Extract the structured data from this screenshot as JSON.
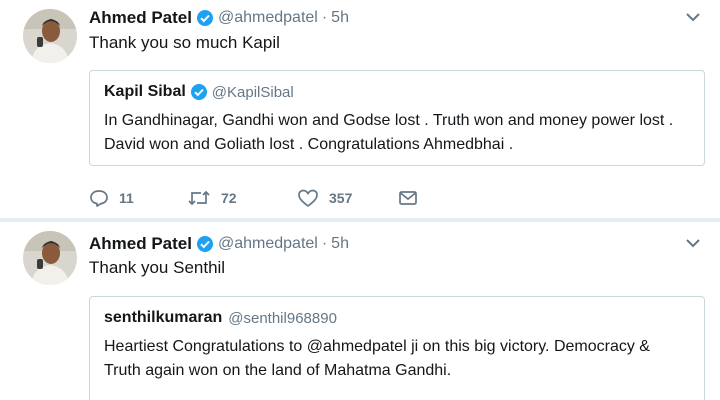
{
  "tweets": [
    {
      "author": {
        "name": "Ahmed Patel",
        "handle": "@ahmedpatel",
        "verified": true
      },
      "time": "5h",
      "separator": "·",
      "text": "Thank you so much Kapil",
      "quote": {
        "name": "Kapil Sibal",
        "handle": "@KapilSibal",
        "verified": true,
        "text": "In Gandhinagar, Gandhi won and Godse lost . Truth won and money power lost . David won and Goliath lost . Congratulations Ahmedbhai ."
      },
      "actions": {
        "replies": "11",
        "retweets": "72",
        "likes": "357"
      }
    },
    {
      "author": {
        "name": "Ahmed Patel",
        "handle": "@ahmedpatel",
        "verified": true
      },
      "time": "5h",
      "separator": "·",
      "text": "Thank you Senthil",
      "quote": {
        "name": "senthilkumaran",
        "handle": "@senthil968890",
        "verified": false,
        "text": "Heartiest Congratulations to @ahmedpatel ji on this big victory. Democracy & Truth again won on the land of Mahatma Gandhi."
      }
    }
  ],
  "icons": {
    "verified": "verified-badge-icon",
    "menu": "chevron-down-icon",
    "reply": "reply-icon",
    "retweet": "retweet-icon",
    "like": "heart-icon",
    "message": "envelope-icon"
  },
  "colors": {
    "verified": "#1da1f2",
    "secondary_text": "#657786",
    "border": "#ccd6dd",
    "separator": "#e6ecf0"
  }
}
